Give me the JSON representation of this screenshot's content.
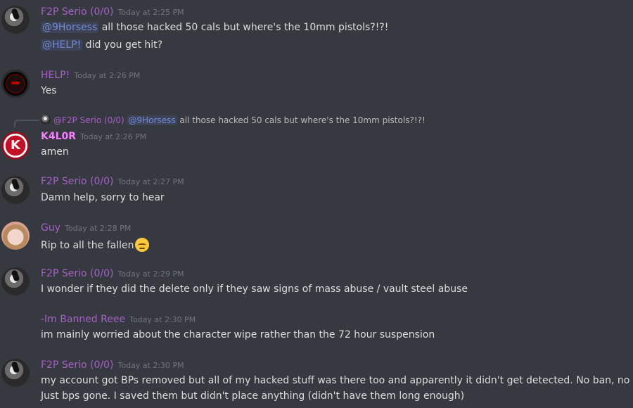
{
  "colors": {
    "background": "#36393f",
    "serio": "#a561c8",
    "help": "#a561c8",
    "k4lor": "#f47fff",
    "guy": "#a561c8",
    "banned": "#a561c8",
    "mention": "#7289da"
  },
  "messages": [
    {
      "author": "F2P Serio (0/0)",
      "time": "Today at 2:25 PM",
      "lines": [
        {
          "mention": "@9Horsess",
          "text": " all those hacked 50 cals but where's the 10mm pistols?!?!"
        },
        {
          "mention": "@HELP!",
          "text": " did you get hit?"
        }
      ]
    },
    {
      "author": "HELP!",
      "time": "Today at 2:26 PM",
      "lines": [
        {
          "text": "Yes"
        }
      ]
    },
    {
      "reply": {
        "author": "@F2P Serio (0/0)",
        "mention": "@9Horsess",
        "text": " all those hacked 50 cals but where's the 10mm pistols?!?!"
      },
      "author": "K4L0R",
      "avatar_letter": "K",
      "time": "Today at 2:26 PM",
      "lines": [
        {
          "text": "amen"
        }
      ]
    },
    {
      "author": "F2P Serio (0/0)",
      "time": "Today at 2:27 PM",
      "lines": [
        {
          "text": "Damn help, sorry to hear"
        }
      ]
    },
    {
      "author": "Guy",
      "time": "Today at 2:28 PM",
      "lines": [
        {
          "text": "Rip to all the fallen",
          "emoji": "pensive-face"
        }
      ]
    },
    {
      "author": "F2P Serio (0/0)",
      "time": "Today at 2:29 PM",
      "lines": [
        {
          "text": "I wonder if they did the delete only if they saw signs of mass abuse / vault steel abuse"
        }
      ]
    },
    {
      "author": "-Im Banned Reee",
      "time": "Today at 2:30 PM",
      "lines": [
        {
          "text": "im mainly worried about the character wipe rather than the 72 hour suspension"
        }
      ]
    },
    {
      "author": "F2P Serio (0/0)",
      "time": "Today at 2:30 PM",
      "lines": [
        {
          "text": "my account got BPs removed but all of my hacked stuff was there too and apparently it didn't get detected.   No ban, no wipe."
        },
        {
          "text": "Just bps gone.   I saved them but didn't place anything (didn't have them long enough)"
        }
      ]
    }
  ]
}
